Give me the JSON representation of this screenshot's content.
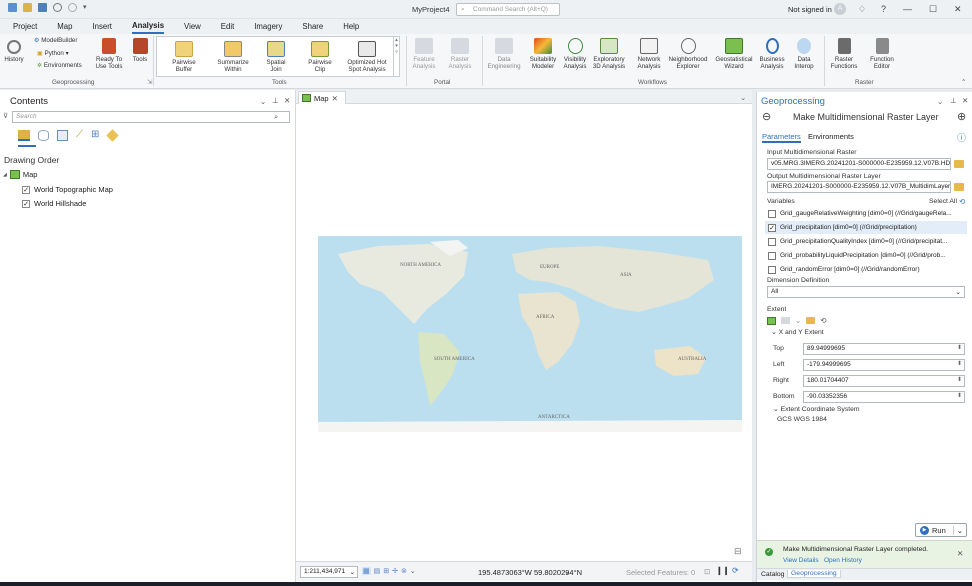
{
  "titlebar": {
    "project": "MyProject4",
    "search_placeholder": "Command Search (Alt+Q)",
    "signin": "Not signed in",
    "avatar": "A",
    "help": "?",
    "minimize": "—",
    "maximize": "☐",
    "close": "✕"
  },
  "menu": [
    "Project",
    "Map",
    "Insert",
    "Analysis",
    "View",
    "Edit",
    "Imagery",
    "Share",
    "Help"
  ],
  "ribbon": {
    "geoprocessing": {
      "history": "History",
      "modelbuilder": "ModelBuilder",
      "python": "Python",
      "environments": "Environments",
      "ready_to_use": "Ready To Use Tools",
      "tools": "Tools",
      "group": "Geoprocessing"
    },
    "tools_gallery": [
      "Pairwise Buffer",
      "Summarize Within",
      "Spatial Join",
      "Pairwise Clip",
      "Optimized Hot Spot Analysis"
    ],
    "tools_group": "Tools",
    "portal": [
      "Feature Analysis",
      "Raster Analysis"
    ],
    "portal_group": "Portal",
    "workflows": [
      "Data Engineering",
      "Suitability Modeler",
      "Visibility Analysis",
      "Exploratory 3D Analysis",
      "Network Analysis",
      "Neighborhood Explorer",
      "Geostatistical Wizard",
      "Business Analysis",
      "Data Interop"
    ],
    "workflows_group": "Workflows",
    "raster": [
      "Raster Functions",
      "Function Editor"
    ],
    "raster_group": "Raster"
  },
  "contents": {
    "title": "Contents",
    "search_placeholder": "Search",
    "drawing_order": "Drawing Order",
    "map": "Map",
    "layers": [
      "World Topographic Map",
      "World Hillshade"
    ]
  },
  "map": {
    "tab": "Map",
    "scale": "1:211,434,971",
    "coords": "195.4873063°W 59.8020294°N",
    "selected": "Selected Features: 0",
    "labels": [
      "NORTH AMERICA",
      "EUROPE",
      "ASIA",
      "AFRICA",
      "SOUTH AMERICA",
      "AUSTRALIA",
      "ANTARCTICA"
    ]
  },
  "gp": {
    "pane": "Geoprocessing",
    "tool": "Make Multidimensional Raster Layer",
    "tabs": [
      "Parameters",
      "Environments"
    ],
    "input_label": "Input Multidimensional Raster",
    "input_value": "v05.MRG.3IMERG.20241201-S000000-E235959.12.V07B.HDF5",
    "output_label": "Output Multidimensional Raster Layer",
    "output_value": "IMERG.20241201-S000000-E235959.12.V07B_MultidimLayer",
    "variables_label": "Variables",
    "select_all": "Select All",
    "variables": [
      {
        "name": "Grid_gaugeRelativeWeighting [dim0=0] (//Grid/gaugeRela...",
        "checked": false
      },
      {
        "name": "Grid_precipitation [dim0=0] (//Grid/precipitation)",
        "checked": true
      },
      {
        "name": "Grid_precipitationQualityIndex [dim0=0] (//Grid/precipitat...",
        "checked": false
      },
      {
        "name": "Grid_probabilityLiquidPrecipitation [dim0=0] (//Grid/prob...",
        "checked": false
      },
      {
        "name": "Grid_randomError [dim0=0] (//Grid/randomError)",
        "checked": false
      }
    ],
    "dim_label": "Dimension Definition",
    "dim_value": "All",
    "extent_label": "Extent",
    "xy_label": "X and Y Extent",
    "top_label": "Top",
    "top": "89.94999695",
    "left_label": "Left",
    "left": "-179.94999695",
    "right_label": "Right",
    "right": "180.01704407",
    "bottom_label": "Bottom",
    "bottom": "-90.03352356",
    "coord_label": "Extent Coordinate System",
    "coord_value": "GCS WGS 1984",
    "run": "Run",
    "completed": "Make Multidimensional Raster Layer completed.",
    "view_details": "View Details",
    "open_history": "Open History",
    "bottom_tabs": [
      "Catalog",
      "Geoprocessing"
    ]
  }
}
